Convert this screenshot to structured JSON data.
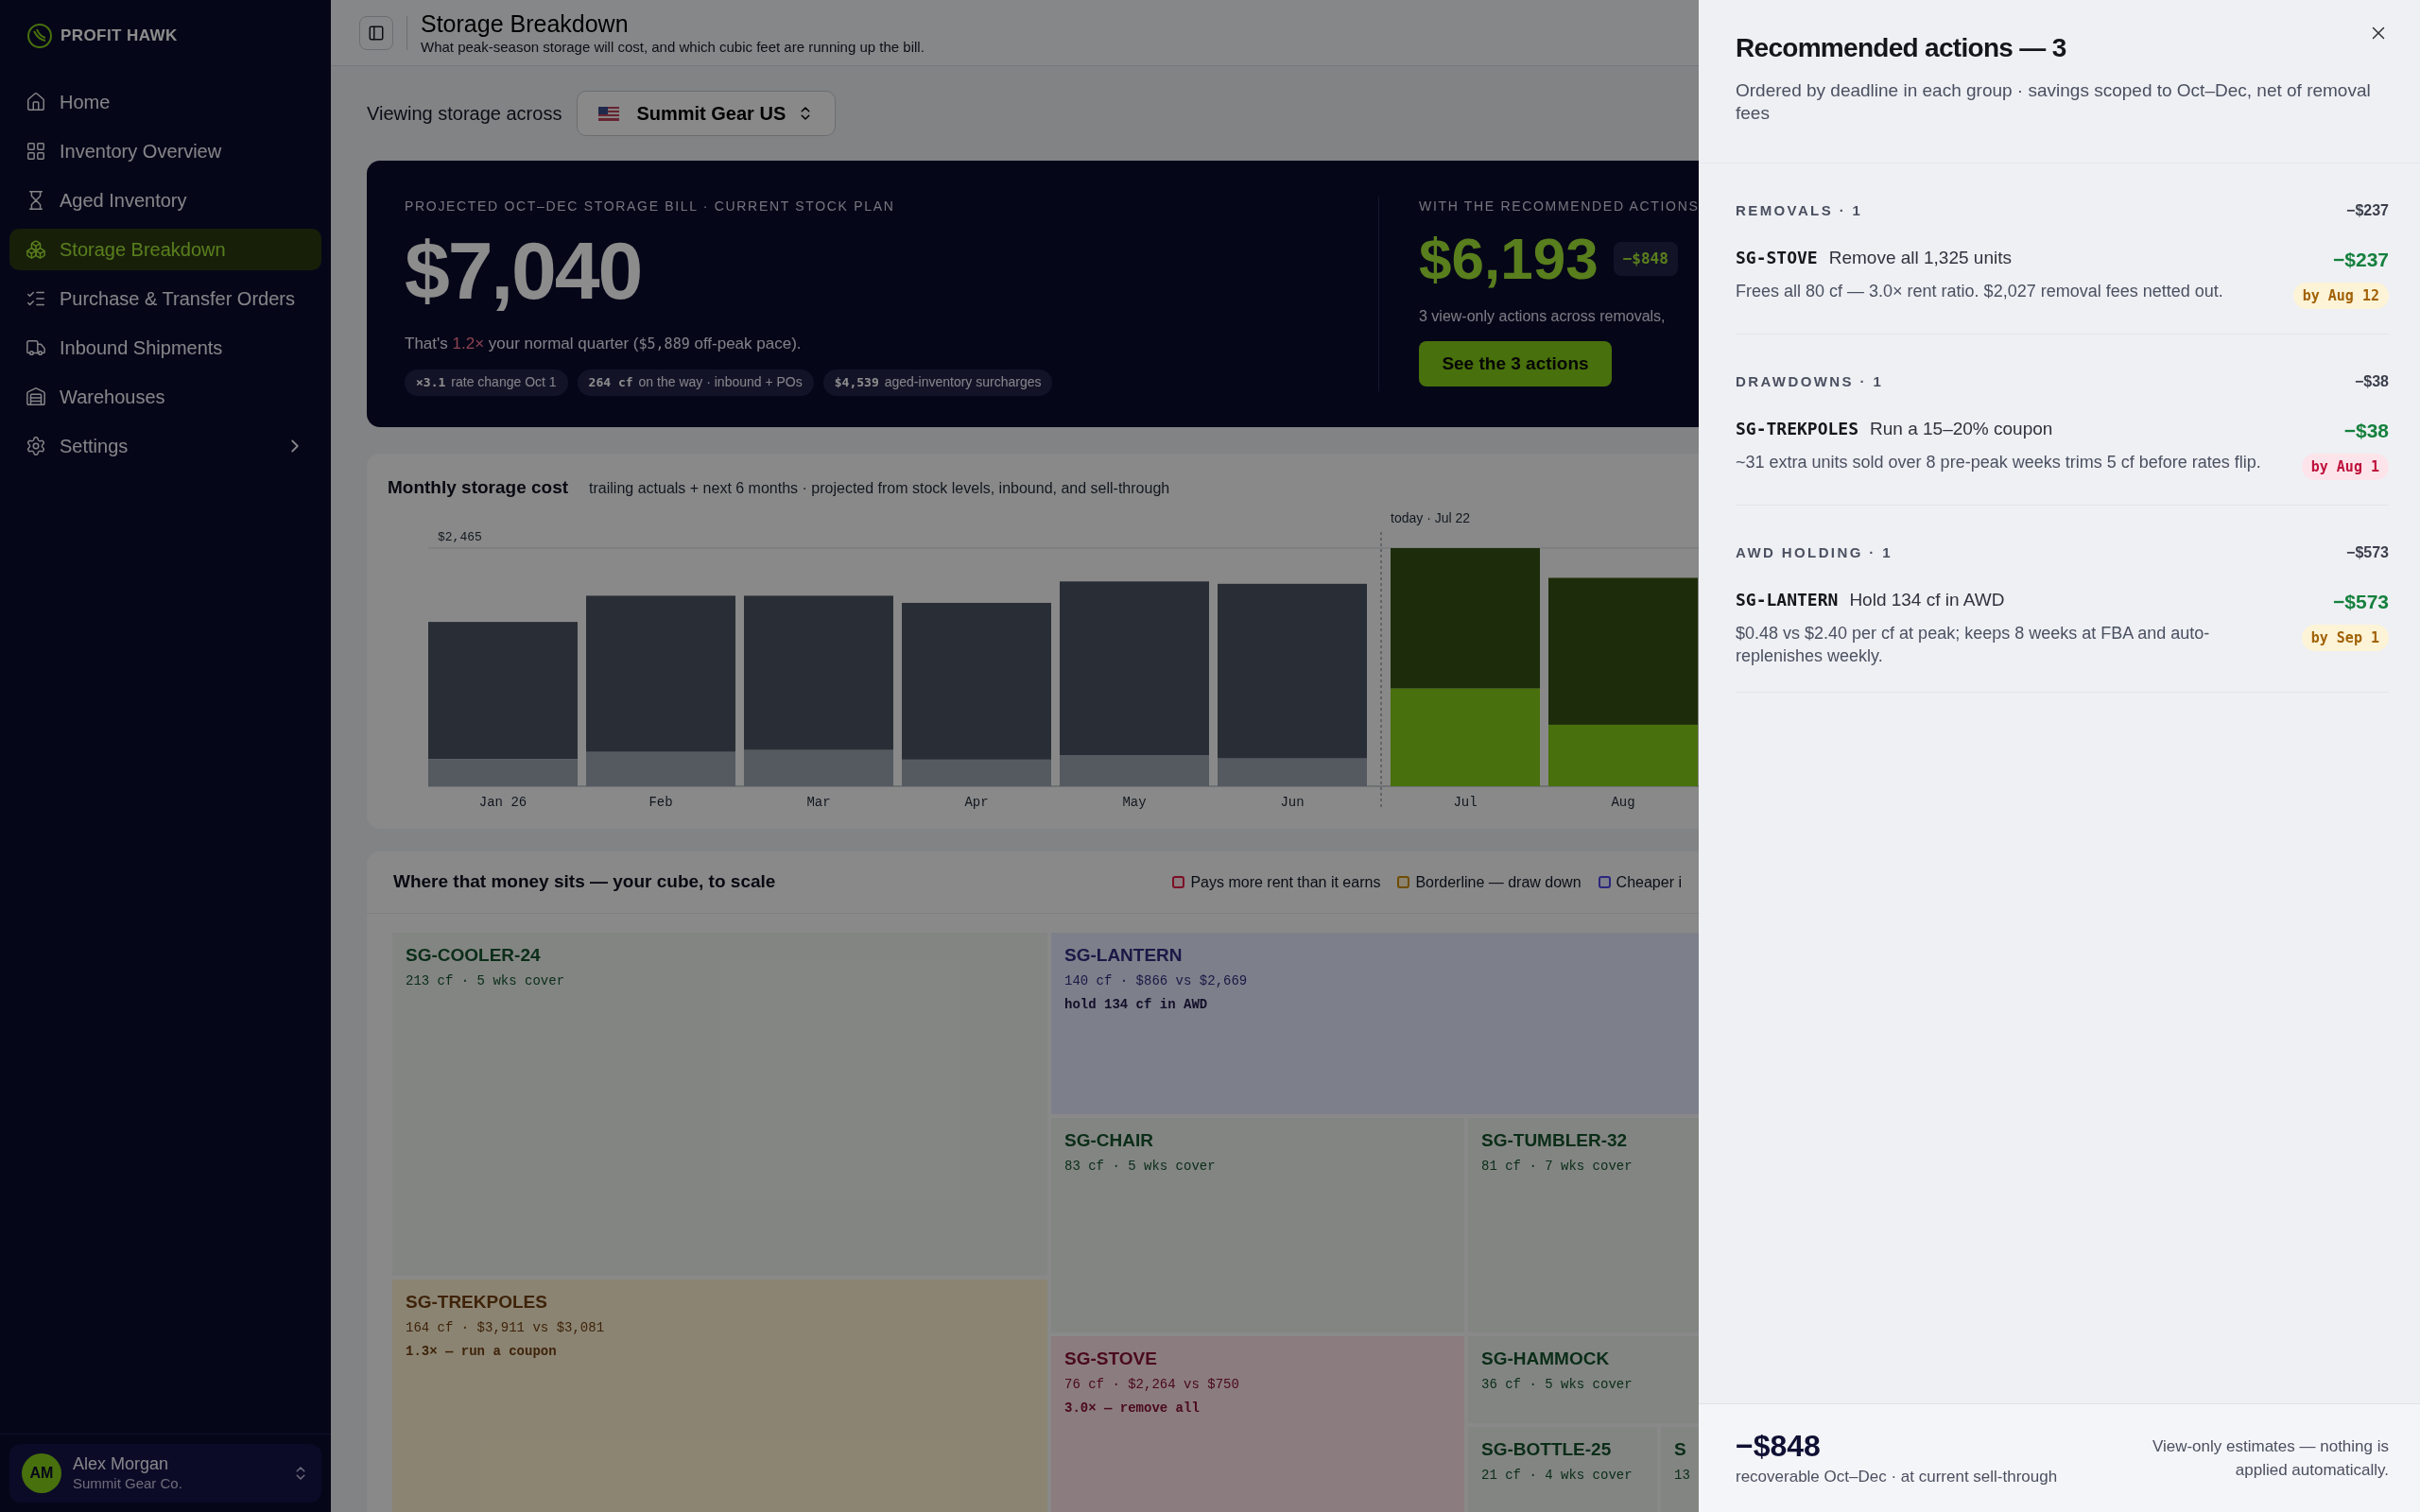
{
  "brand": {
    "name": "PROFIT HAWK"
  },
  "sidebar": {
    "items": [
      {
        "label": "Home",
        "selected": false,
        "has_submenu": false
      },
      {
        "label": "Inventory Overview",
        "selected": false,
        "has_submenu": false
      },
      {
        "label": "Aged Inventory",
        "selected": false,
        "has_submenu": false
      },
      {
        "label": "Storage Breakdown",
        "selected": true,
        "has_submenu": false
      },
      {
        "label": "Purchase & Transfer Orders",
        "selected": false,
        "has_submenu": false
      },
      {
        "label": "Inbound Shipments",
        "selected": false,
        "has_submenu": false
      },
      {
        "label": "Warehouses",
        "selected": false,
        "has_submenu": false
      },
      {
        "label": "Settings",
        "selected": false,
        "has_submenu": true
      }
    ],
    "user": {
      "initials": "AM",
      "name": "Alex Morgan",
      "company": "Summit Gear Co."
    }
  },
  "header": {
    "title": "Storage Breakdown",
    "subtitle": "What peak-season storage will cost, and which cubic feet are running up the bill."
  },
  "scope": {
    "label": "Viewing storage across",
    "value": "Summit Gear US"
  },
  "hero": {
    "label": "PROJECTED OCT–DEC STORAGE BILL · CURRENT STOCK PLAN",
    "amount": "$7,040",
    "sentence": [
      {
        "kind": "plain",
        "text": "That's "
      },
      {
        "kind": "ratio",
        "text": "1.2×"
      },
      {
        "kind": "plain",
        "text": " your normal quarter ("
      },
      {
        "kind": "mono",
        "text": "$5,889"
      },
      {
        "kind": "plain",
        "text": " off-peak pace)."
      }
    ],
    "chips": [
      {
        "value": "×3.1",
        "label": "rate change Oct 1"
      },
      {
        "value": "264 cf",
        "label": "on the way · inbound + POs"
      },
      {
        "value": "$4,539",
        "label": "aged-inventory surcharges"
      }
    ],
    "with_actions": {
      "label": "WITH THE RECOMMENDED ACTIONS",
      "amount": "$6,193",
      "delta": "−$848",
      "note": "3 view-only actions across removals,",
      "button": "See the 3 actions"
    }
  },
  "monthly_chart": {
    "title": "Monthly storage cost",
    "subtitle": "trailing actuals + next 6 months · projected from stock levels, inbound, and sell-through",
    "peak_label": "$2,465",
    "today_label": "today · Jul 22",
    "months": [
      {
        "label": "Jan 26",
        "projected": false
      },
      {
        "label": "Feb",
        "projected": false
      },
      {
        "label": "Mar",
        "projected": false
      },
      {
        "label": "Apr",
        "projected": false
      },
      {
        "label": "May",
        "projected": false
      },
      {
        "label": "Jun",
        "projected": false
      },
      {
        "label": "Jul",
        "projected": true
      },
      {
        "label": "Aug",
        "projected": true
      }
    ]
  },
  "cube": {
    "title": "Where that money sits — your cube, to scale",
    "legend": [
      {
        "label": "Pays more rent than it earns",
        "kind": "rent"
      },
      {
        "label": "Borderline — draw down",
        "kind": "borderline"
      },
      {
        "label": "Cheaper i",
        "kind": "awd"
      }
    ],
    "tiles": [
      {
        "kind": "healthy",
        "name": "SG-COOLER-24",
        "meta": "213 cf · 5 wks cover"
      },
      {
        "kind": "borderline",
        "name": "SG-TREKPOLES",
        "meta": "164 cf · $3,911 vs $3,081",
        "note": "1.3× — run a coupon"
      },
      {
        "kind": "awd",
        "name": "SG-LANTERN",
        "meta": "140 cf · $866 vs $2,669",
        "note": "hold 134 cf in AWD"
      },
      {
        "kind": "healthy",
        "name": "SG-CHAIR",
        "meta": "83 cf · 5 wks cover"
      },
      {
        "kind": "rent",
        "name": "SG-STOVE",
        "meta": "76 cf · $2,264 vs $750",
        "note": "3.0× — remove all"
      },
      {
        "kind": "healthy",
        "name": "SG-TUMBLER-32",
        "meta": "81 cf · 7 wks cover"
      },
      {
        "kind": "healthy",
        "name": "SG-HAMMOCK",
        "meta": "36 cf · 5 wks cover"
      },
      {
        "kind": "healthy",
        "name": "SG-BOTTLE-25",
        "meta": "21 cf · 4 wks cover"
      },
      {
        "kind": "healthy",
        "name": "S",
        "meta": "13"
      }
    ]
  },
  "drawer": {
    "title": "Recommended actions — 3",
    "description": "Ordered by deadline in each group · savings scoped to Oct–Dec, net of removal fees",
    "groups": [
      {
        "label": "REMOVALS · 1",
        "total": "−$237",
        "actions": [
          {
            "sku": "SG-STOVE",
            "title": "Remove all 1,325 units",
            "detail": "Frees all 80 cf — 3.0× rent ratio. $2,027 removal fees netted out.",
            "amount": "−$237",
            "deadline": "by Aug 12",
            "urgent": false
          }
        ]
      },
      {
        "label": "DRAWDOWNS · 1",
        "total": "−$38",
        "actions": [
          {
            "sku": "SG-TREKPOLES",
            "title": "Run a 15–20% coupon",
            "detail": "~31 extra units sold over 8 pre-peak weeks trims 5 cf before rates flip.",
            "amount": "−$38",
            "deadline": "by Aug 1",
            "urgent": true
          }
        ]
      },
      {
        "label": "AWD HOLDING · 1",
        "total": "−$573",
        "actions": [
          {
            "sku": "SG-LANTERN",
            "title": "Hold 134 cf in AWD",
            "detail": "$0.48 vs $2.40 per cf at peak; keeps 8 weeks at FBA and auto-replenishes weekly.",
            "amount": "−$573",
            "deadline": "by Sep 1",
            "urgent": false
          }
        ]
      }
    ],
    "footer": {
      "amount": "−$848",
      "caption": "recoverable Oct–Dec · at current sell-through",
      "note": "View-only estimates — nothing is applied automatically."
    }
  }
}
